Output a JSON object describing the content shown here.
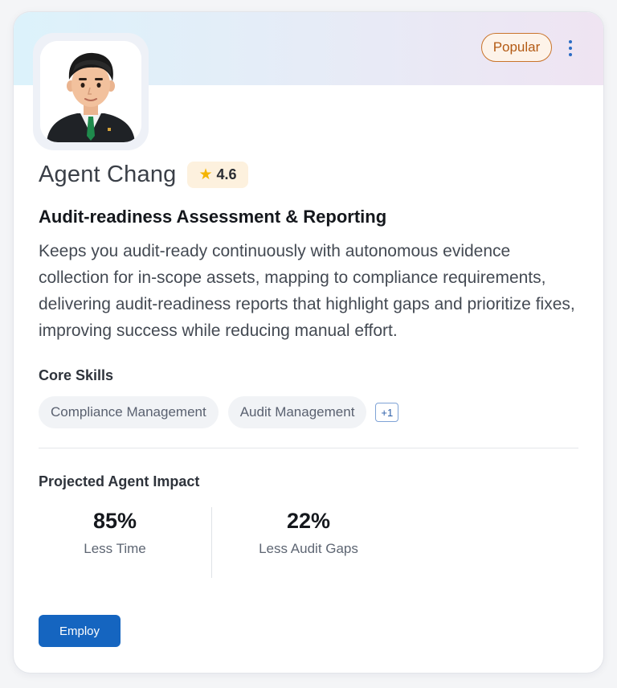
{
  "agent": {
    "name": "Agent Chang",
    "rating": "4.6",
    "badge": "Popular",
    "title": "Audit-readiness Assessment & Reporting",
    "description": "Keeps you audit-ready continuously with autonomous evidence collection for in-scope assets, mapping to compliance requirements, delivering audit-readiness reports that highlight gaps and prioritize fixes, improving success while reducing manual effort."
  },
  "skills": {
    "label": "Core Skills",
    "items": [
      "Compliance Management",
      "Audit Management"
    ],
    "more_count": "+1"
  },
  "impact": {
    "label": "Projected Agent Impact",
    "metrics": [
      {
        "value": "85%",
        "label": "Less Time"
      },
      {
        "value": "22%",
        "label": "Less Audit Gaps"
      }
    ]
  },
  "actions": {
    "employ_label": "Employ"
  },
  "icons": {
    "more": "more-vertical-icon",
    "rating": "star-icon",
    "avatar": "agent-avatar"
  },
  "colors": {
    "primary": "#1565c0",
    "badge_border": "#c9742b",
    "star": "#f4b400"
  }
}
